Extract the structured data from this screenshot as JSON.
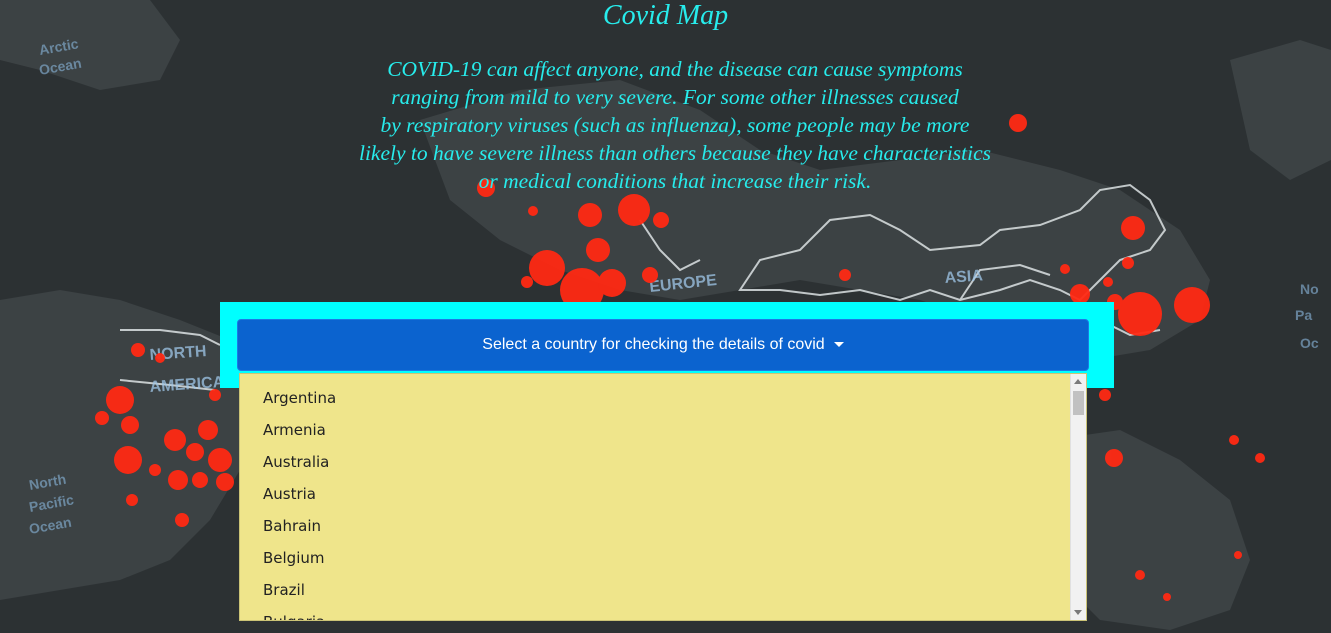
{
  "header": {
    "title": "Covid Map",
    "intro_lines": [
      "COVID-19 can affect anyone, and the disease can cause symptoms",
      "ranging from mild to very severe. For some other illnesses caused",
      "by respiratory viruses (such as influenza), some people may be more",
      "likely to have severe illness than others because they have characteristics",
      "or medical conditions that increase their risk."
    ]
  },
  "map": {
    "labels": [
      "EUROPE",
      "ASIA",
      "NORTH AMERICA"
    ],
    "marker_color": "#ff2a14"
  },
  "dropdown": {
    "button_label": "Select a country for checking the details of covid",
    "countries": [
      "Argentina",
      "Armenia",
      "Australia",
      "Austria",
      "Bahrain",
      "Belgium",
      "Brazil",
      "Bulgaria"
    ]
  },
  "colors": {
    "title_text": "#27ecec",
    "panel": "#00ffff",
    "button": "#0b63cf",
    "menu": "#efe58b"
  }
}
